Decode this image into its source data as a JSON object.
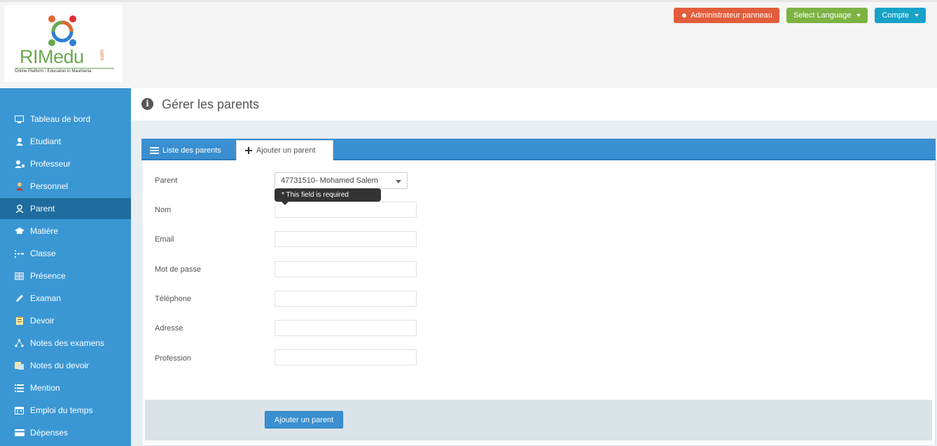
{
  "brand": {
    "name": "RIMedu",
    "suffix": "com",
    "tagline": "Online Platform - Education in Mauritania",
    "colors": {
      "green": "#6aa84f",
      "orange": "#e06a2c",
      "blue": "#2e7fd0",
      "red": "#d33"
    }
  },
  "topbar": {
    "admin_label": "Administrateur panneau",
    "language_label": "Select Language",
    "account_label": "Compte",
    "colors": {
      "admin": "#e25d3b",
      "language": "#7cb342",
      "account": "#17a2c8"
    }
  },
  "sidebar": {
    "items": [
      {
        "label": "Tableau de bord",
        "icon": "monitor-icon"
      },
      {
        "label": "Etudiant",
        "icon": "student-icon"
      },
      {
        "label": "Professeur",
        "icon": "teacher-icon"
      },
      {
        "label": "Personnel",
        "icon": "staff-icon"
      },
      {
        "label": "Parent",
        "icon": "parent-icon",
        "active": true
      },
      {
        "label": "Matiére",
        "icon": "graduation-cap-icon"
      },
      {
        "label": "Classe",
        "icon": "class-icon"
      },
      {
        "label": "Présence",
        "icon": "attendance-icon"
      },
      {
        "label": "Examan",
        "icon": "pencil-icon"
      },
      {
        "label": "Devoir",
        "icon": "assignment-icon"
      },
      {
        "label": "Notes des examens",
        "icon": "network-icon"
      },
      {
        "label": "Notes du devoir",
        "icon": "notes-icon"
      },
      {
        "label": "Mention",
        "icon": "list-icon"
      },
      {
        "label": "Emploi du temps",
        "icon": "calendar-icon"
      },
      {
        "label": "Dépenses",
        "icon": "credit-card-icon"
      }
    ]
  },
  "header": {
    "title": "Gérer les parents",
    "icon": "info-icon"
  },
  "tabs": {
    "list_label": "Liste des parents",
    "add_label": "Ajouter un parent"
  },
  "form": {
    "parent_label": "Parent",
    "parent_value": "47731510- Mohamed Salem",
    "tooltip": "* This field is required",
    "fields": [
      {
        "label": "Nom",
        "value": ""
      },
      {
        "label": "Email",
        "value": ""
      },
      {
        "label": "Mot de passe",
        "value": ""
      },
      {
        "label": "Téléphone",
        "value": ""
      },
      {
        "label": "Adresse",
        "value": ""
      },
      {
        "label": "Profession",
        "value": ""
      }
    ],
    "submit_label": "Ajouter un parent"
  }
}
